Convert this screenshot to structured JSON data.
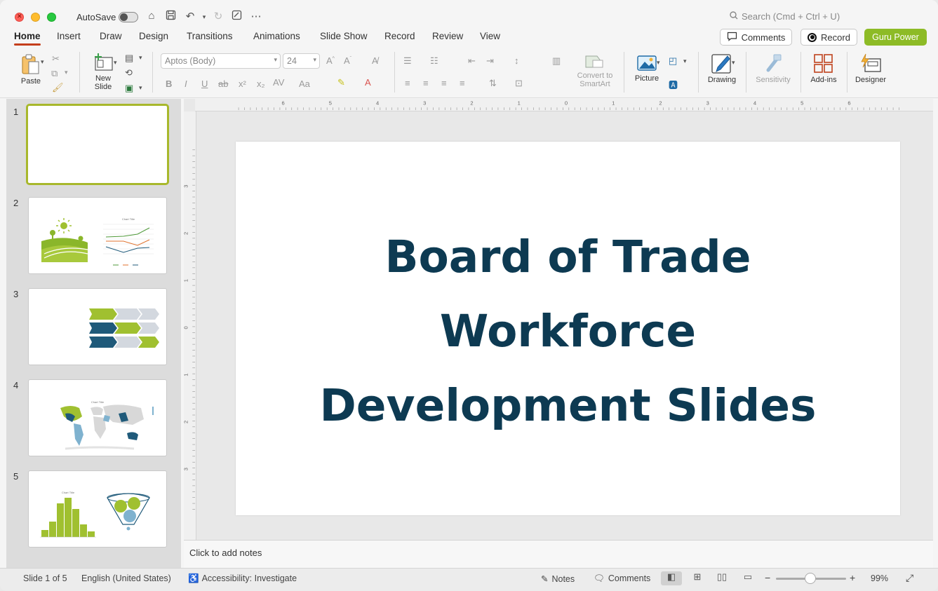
{
  "titlebar": {
    "autosave_label": "AutoSave",
    "search_placeholder": "Search (Cmd + Ctrl + U)"
  },
  "tabs": [
    "Home",
    "Insert",
    "Draw",
    "Design",
    "Transitions",
    "Animations",
    "Slide Show",
    "Record",
    "Review",
    "View"
  ],
  "header_buttons": {
    "comments": "Comments",
    "record": "Record",
    "guru": "Guru Power"
  },
  "ribbon": {
    "paste": "Paste",
    "new_slide_1": "New",
    "new_slide_2": "Slide",
    "font_name": "Aptos (Body)",
    "font_size": "24",
    "convert_1": "Convert to",
    "convert_2": "SmartArt",
    "picture": "Picture",
    "drawing": "Drawing",
    "sensitivity": "Sensitivity",
    "addins": "Add-ins",
    "designer": "Designer"
  },
  "thumbnails": [
    {
      "num": "1"
    },
    {
      "num": "2",
      "chart_title": "Chart Title"
    },
    {
      "num": "3"
    },
    {
      "num": "4",
      "chart_title": "Chart Title"
    },
    {
      "num": "5",
      "chart_title": "Chart Title"
    }
  ],
  "ruler": {
    "h_labels": [
      "6",
      "5",
      "4",
      "3",
      "2",
      "1",
      "0",
      "1",
      "2",
      "3",
      "4",
      "5",
      "6"
    ],
    "v_labels": [
      "3",
      "2",
      "1",
      "0",
      "1",
      "2",
      "3"
    ]
  },
  "slide": {
    "title_line1": "Board of Trade",
    "title_line2": "Workforce",
    "title_line3": "Development Slides"
  },
  "notes_placeholder": "Click to add notes",
  "status": {
    "slide_count": "Slide 1 of 5",
    "language": "English (United States)",
    "accessibility": "Accessibility: Investigate",
    "notes": "Notes",
    "comments": "Comments",
    "zoom": "99%"
  },
  "colors": {
    "accent_green": "#8dbb26",
    "title_navy": "#0d3a52",
    "tab_underline": "#c43e1c"
  }
}
